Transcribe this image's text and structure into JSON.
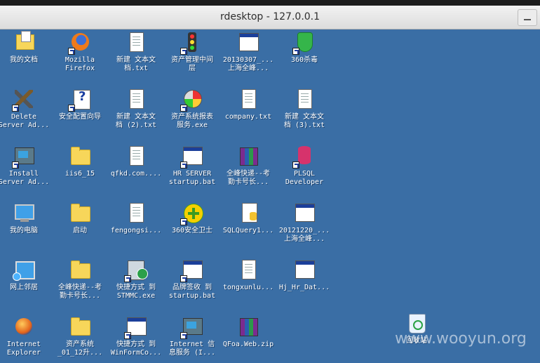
{
  "window": {
    "title": "rdesktop - 127.0.0.1"
  },
  "watermark": "www.wooyun.org",
  "icons": [
    {
      "label": "我的文档",
      "icon": "my-documents-icon"
    },
    {
      "label": "Mozilla\nFirefox",
      "icon": "firefox-icon"
    },
    {
      "label": "新建 文本文\n档.txt",
      "icon": "text-file-icon"
    },
    {
      "label": "资产管理中间\n层",
      "icon": "traffic-light-icon"
    },
    {
      "label": "20130307_...\n上海全峰...",
      "icon": "window-file-icon"
    },
    {
      "label": "360杀毒",
      "icon": "360-antivirus-icon"
    },
    {
      "label": "Delete\nServer Ad...",
      "icon": "tools-icon"
    },
    {
      "label": "安全配置向导",
      "icon": "wizard-icon"
    },
    {
      "label": "新建 文本文\n档 (2).txt",
      "icon": "text-file-icon"
    },
    {
      "label": "资产系统报表\n服务.exe",
      "icon": "gauge-icon"
    },
    {
      "label": "company.txt",
      "icon": "text-file-icon"
    },
    {
      "label": "新建 文本文\n档 (3).txt",
      "icon": "text-file-icon"
    },
    {
      "label": "Install\nServer Ad...",
      "icon": "installer-icon"
    },
    {
      "label": "iis6_15",
      "icon": "folder-icon"
    },
    {
      "label": "qfkd.com....",
      "icon": "text-file-icon"
    },
    {
      "label": "HR SERVER\nstartup.bat",
      "icon": "batch-file-icon"
    },
    {
      "label": "全峰快递--考\n勤卡号长...",
      "icon": "rar-icon"
    },
    {
      "label": "PLSQL\nDeveloper",
      "icon": "database-icon"
    },
    {
      "label": "我的电脑",
      "icon": "my-computer-icon"
    },
    {
      "label": "启动",
      "icon": "folder-icon"
    },
    {
      "label": "fengongsi...",
      "icon": "text-file-icon"
    },
    {
      "label": "360安全卫士",
      "icon": "360-safeguard-icon"
    },
    {
      "label": "SQLQuery1...",
      "icon": "sql-file-icon"
    },
    {
      "label": "20121220_...\n上海全峰...",
      "icon": "window-file-icon"
    },
    {
      "label": "网上邻居",
      "icon": "network-icon"
    },
    {
      "label": "全峰快递--考\n勤卡号长...",
      "icon": "folder-icon"
    },
    {
      "label": "快捷方式 到\nSTMMC.exe",
      "icon": "setup-icon"
    },
    {
      "label": "品牌签收 到\nstartup.bat",
      "icon": "batch-file-icon"
    },
    {
      "label": "tongxunlu...",
      "icon": "text-file-icon"
    },
    {
      "label": "Hj_Hr_Dat...",
      "icon": "window-file-icon"
    },
    {
      "label": "Internet\nExplorer",
      "icon": "internet-explorer-icon"
    },
    {
      "label": "资产系统\n_01_12升...",
      "icon": "folder-icon"
    },
    {
      "label": "快捷方式 到\nWinFormCo...",
      "icon": "application-icon"
    },
    {
      "label": "Internet 信\n息服务 (I...",
      "icon": "iis-icon"
    },
    {
      "label": "QFoa.Web.zip",
      "icon": "rar-icon"
    },
    {
      "label": "回收站",
      "icon": "recycle-bin-icon"
    }
  ]
}
